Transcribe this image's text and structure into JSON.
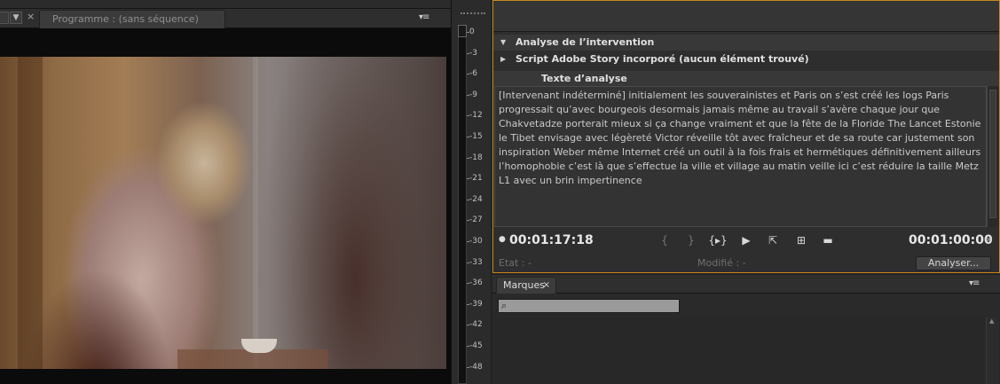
{
  "program_monitor": {
    "tab_label": "Programme : (sans séquence)",
    "close_glyph": "×",
    "menu_glyph": "▾≡",
    "dropdown_glyph": "▼",
    "video_alt": "woman reading in café"
  },
  "audio_meter": {
    "ticks": [
      "0",
      "-3",
      "-6",
      "-9",
      "-12",
      "-15",
      "-18",
      "-21",
      "-24",
      "-27",
      "-30",
      "-33",
      "-36",
      "-39",
      "-42",
      "-45",
      "-48"
    ]
  },
  "analysis_panel": {
    "section_analysis": "Analyse de l’intervention",
    "section_script": "Script Adobe Story incorporé (aucun élément trouvé)",
    "section_text": "Texte d’analyse",
    "analysis_text": "[Intervenant indéterminé] initialement les souverainistes et Paris on s’est créé les logs Paris progressait qu’avec bourgeois desormais jamais même au travail s’avère chaque jour que Chakvetadze porterait mieux si ça change vraiment et que la fête de la Floride The Lancet Estonie le Tibet envisage avec légèreté Victor réveille tôt avec fraîcheur et de sa route car justement son inspiration Weber même Internet créé un outil à la fois frais et hermétiques définitivement ailleurs l’homophobie c’est là que s’effectue la ville et village au matin veille ici c’est réduire la taille Metz L1 avec un brin impertinence",
    "timecode_current": "00:01:17:18",
    "timecode_duration": "00:01:00:00",
    "status_label": "Etat :  -",
    "modified_label": "Modifié :  -",
    "analyze_button": "Analyser...",
    "controls": {
      "step_back": "{",
      "step_forward": "}",
      "play_in_out": "{▸}",
      "play": "▶",
      "export": "⇱",
      "insert": "⊞",
      "overlay": "▬"
    }
  },
  "marques_panel": {
    "tab_label": "Marques",
    "close_glyph": "×",
    "menu_glyph": "▾≡",
    "search_placeholder": ""
  }
}
